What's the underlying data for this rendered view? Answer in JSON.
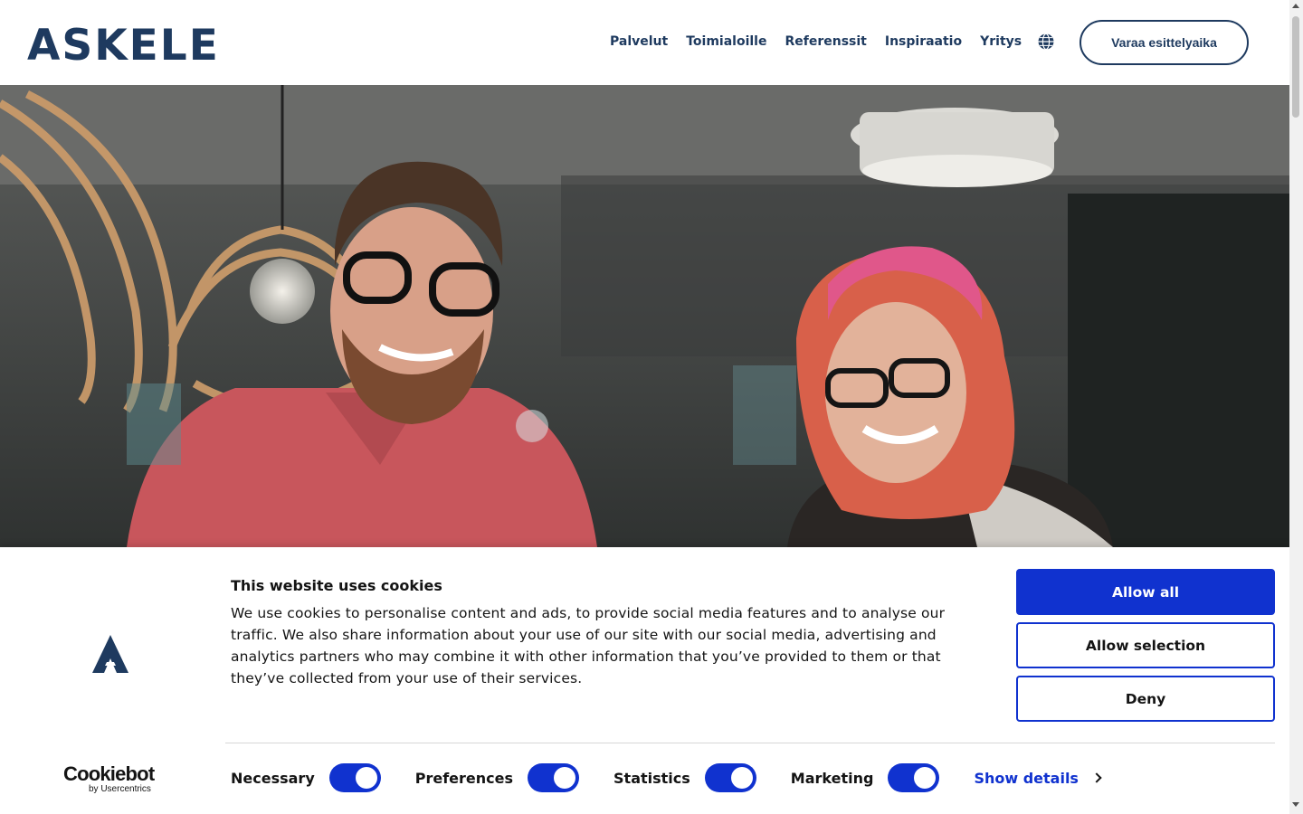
{
  "header": {
    "logo_text": "ASKELE",
    "nav": [
      "Palvelut",
      "Toimialoille",
      "Referenssit",
      "Inspiraatio",
      "Yritys"
    ],
    "language_icon": "globe-icon",
    "cta_label": "Varaa esittelyaika"
  },
  "hero": {
    "image": "photo of a smiling bearded man with glasses and a woman with pink hair and glasses in an office"
  },
  "cookie_banner": {
    "title": "This website uses cookies",
    "text": "We use cookies to personalise content and ads, to provide social media features and to analyse our traffic. We also share information about your use of our site with our social media, advertising and analytics partners who may combine it with other information that you’ve provided to them or that they’ve collected from your use of their services.",
    "allow_all": "Allow all",
    "allow_selection": "Allow selection",
    "deny": "Deny",
    "toggles": [
      {
        "label": "Necessary",
        "checked": true
      },
      {
        "label": "Preferences",
        "checked": true
      },
      {
        "label": "Statistics",
        "checked": true
      },
      {
        "label": "Marketing",
        "checked": true
      }
    ],
    "show_details": "Show details",
    "brand": "Cookiebot",
    "brand_sub": "by Usercentrics"
  },
  "colors": {
    "brand_navy": "#1e3a5f",
    "cookie_blue": "#1032cf"
  }
}
